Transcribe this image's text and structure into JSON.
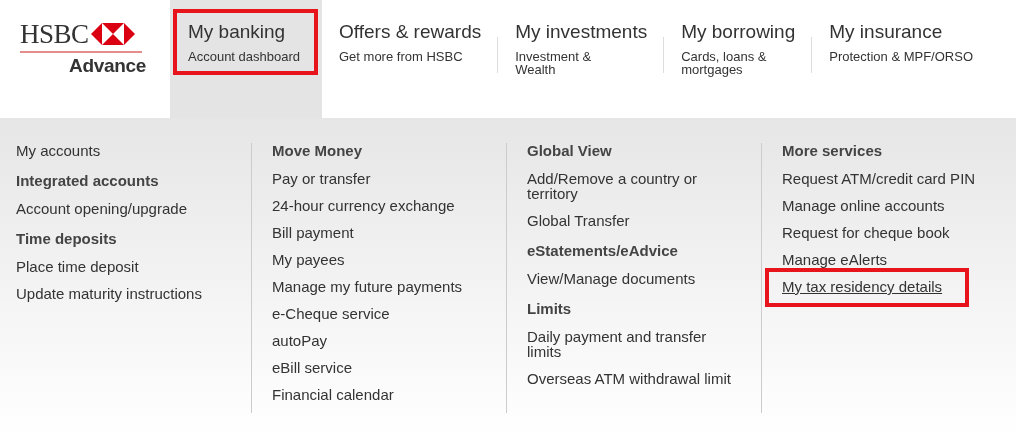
{
  "logo": {
    "name": "HSBC",
    "tier": "Advance"
  },
  "nav": [
    {
      "title": "My banking",
      "subtitle": "Account dashboard",
      "selected": true,
      "highlighted": true
    },
    {
      "title": "Offers & rewards",
      "subtitle": "Get more from HSBC",
      "selected": false,
      "highlighted": false
    },
    {
      "title": "My investments",
      "subtitle": "Investment & Wealth",
      "selected": false,
      "highlighted": false
    },
    {
      "title": "My borrowing",
      "subtitle": "Cards, loans & mortgages",
      "selected": false,
      "highlighted": false
    },
    {
      "title": "My insurance",
      "subtitle": "Protection & MPF/ORSO",
      "selected": false,
      "highlighted": false
    }
  ],
  "menu_columns": [
    {
      "groups": [
        {
          "links": [
            {
              "label": "My accounts",
              "underlined": false,
              "highlighted": false
            }
          ]
        },
        {
          "heading": "Integrated accounts",
          "links": [
            {
              "label": "Account opening/upgrade",
              "underlined": false,
              "highlighted": false
            }
          ]
        },
        {
          "heading": "Time deposits",
          "links": [
            {
              "label": "Place time deposit",
              "underlined": false,
              "highlighted": false
            },
            {
              "label": "Update maturity instructions",
              "underlined": false,
              "highlighted": false
            }
          ]
        }
      ]
    },
    {
      "groups": [
        {
          "heading": "Move Money",
          "links": [
            {
              "label": "Pay or transfer",
              "underlined": false,
              "highlighted": false
            },
            {
              "label": "24-hour currency exchange",
              "underlined": false,
              "highlighted": false
            },
            {
              "label": "Bill payment",
              "underlined": false,
              "highlighted": false
            },
            {
              "label": "My payees",
              "underlined": false,
              "highlighted": false
            },
            {
              "label": "Manage my future payments",
              "underlined": false,
              "highlighted": false
            },
            {
              "label": "e-Cheque service",
              "underlined": false,
              "highlighted": false
            },
            {
              "label": "autoPay",
              "underlined": false,
              "highlighted": false
            },
            {
              "label": "eBill service",
              "underlined": false,
              "highlighted": false
            },
            {
              "label": "Financial calendar",
              "underlined": false,
              "highlighted": false
            }
          ]
        }
      ]
    },
    {
      "groups": [
        {
          "heading": "Global View",
          "links": [
            {
              "label": "Add/Remove a country or territory",
              "underlined": false,
              "highlighted": false
            },
            {
              "label": "Global Transfer",
              "underlined": false,
              "highlighted": false
            }
          ]
        },
        {
          "heading": "eStatements/eAdvice",
          "links": [
            {
              "label": "View/Manage documents",
              "underlined": false,
              "highlighted": false
            }
          ]
        },
        {
          "heading": "Limits",
          "links": [
            {
              "label": "Daily payment and transfer limits",
              "underlined": false,
              "highlighted": false
            },
            {
              "label": "Overseas ATM withdrawal limit",
              "underlined": false,
              "highlighted": false
            }
          ]
        }
      ]
    },
    {
      "groups": [
        {
          "heading": "More services",
          "links": [
            {
              "label": "Request ATM/credit card PIN",
              "underlined": false,
              "highlighted": false
            },
            {
              "label": "Manage online accounts",
              "underlined": false,
              "highlighted": false
            },
            {
              "label": "Request for cheque book",
              "underlined": false,
              "highlighted": false
            },
            {
              "label": "Manage eAlerts",
              "underlined": false,
              "highlighted": false
            },
            {
              "label": "My tax residency details",
              "underlined": true,
              "highlighted": true
            }
          ]
        }
      ]
    }
  ]
}
